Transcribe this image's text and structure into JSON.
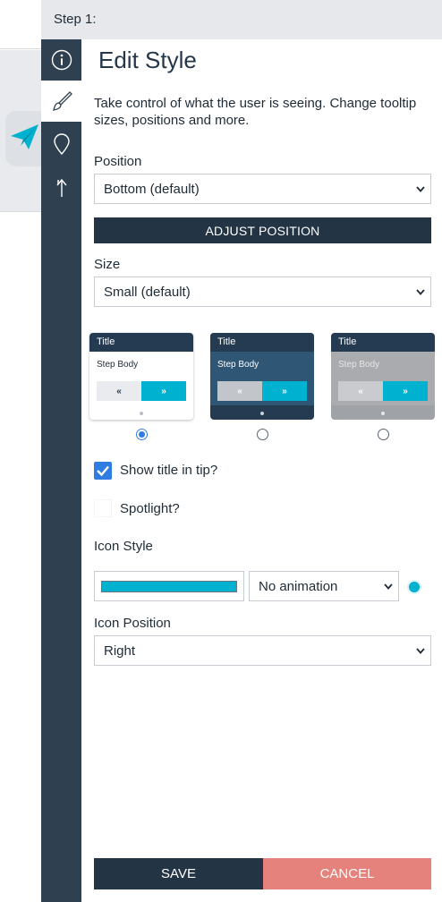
{
  "header": {
    "title": "Step 1:"
  },
  "rail": {
    "items": [
      {
        "icon": "info-icon"
      },
      {
        "icon": "brush-icon",
        "active": true
      },
      {
        "icon": "location-pin-icon"
      },
      {
        "icon": "branch-icon"
      }
    ]
  },
  "panel": {
    "title": "Edit Style",
    "description": "Take control of what the user is seeing. Change tooltip sizes, positions and more.",
    "position_label": "Position",
    "position_value": "Bottom (default)",
    "adjust_button": "ADJUST POSITION",
    "size_label": "Size",
    "size_value": "Small (default)",
    "previews": [
      {
        "title": "Title",
        "body": "Step Body",
        "prev": "«",
        "next": "»",
        "theme": "light",
        "selected": true
      },
      {
        "title": "Title",
        "body": "Step Body",
        "prev": "«",
        "next": "»",
        "theme": "dark",
        "selected": false
      },
      {
        "title": "Title",
        "body": "Step Body",
        "prev": "«",
        "next": "»",
        "theme": "gray",
        "selected": false
      }
    ],
    "show_title_label": "Show title in tip?",
    "show_title_checked": true,
    "spotlight_label": "Spotlight?",
    "spotlight_checked": false,
    "icon_style_label": "Icon Style",
    "icon_color": "#00b2cf",
    "animation_value": "No animation",
    "icon_position_label": "Icon Position",
    "icon_position_value": "Right",
    "save_button": "SAVE",
    "cancel_button": "CANCEL"
  },
  "colors": {
    "rail_bg": "#2f4050",
    "dark_button": "#233445",
    "accent": "#00b2cf",
    "cancel": "#e5827c",
    "check_blue": "#2f7de1"
  }
}
